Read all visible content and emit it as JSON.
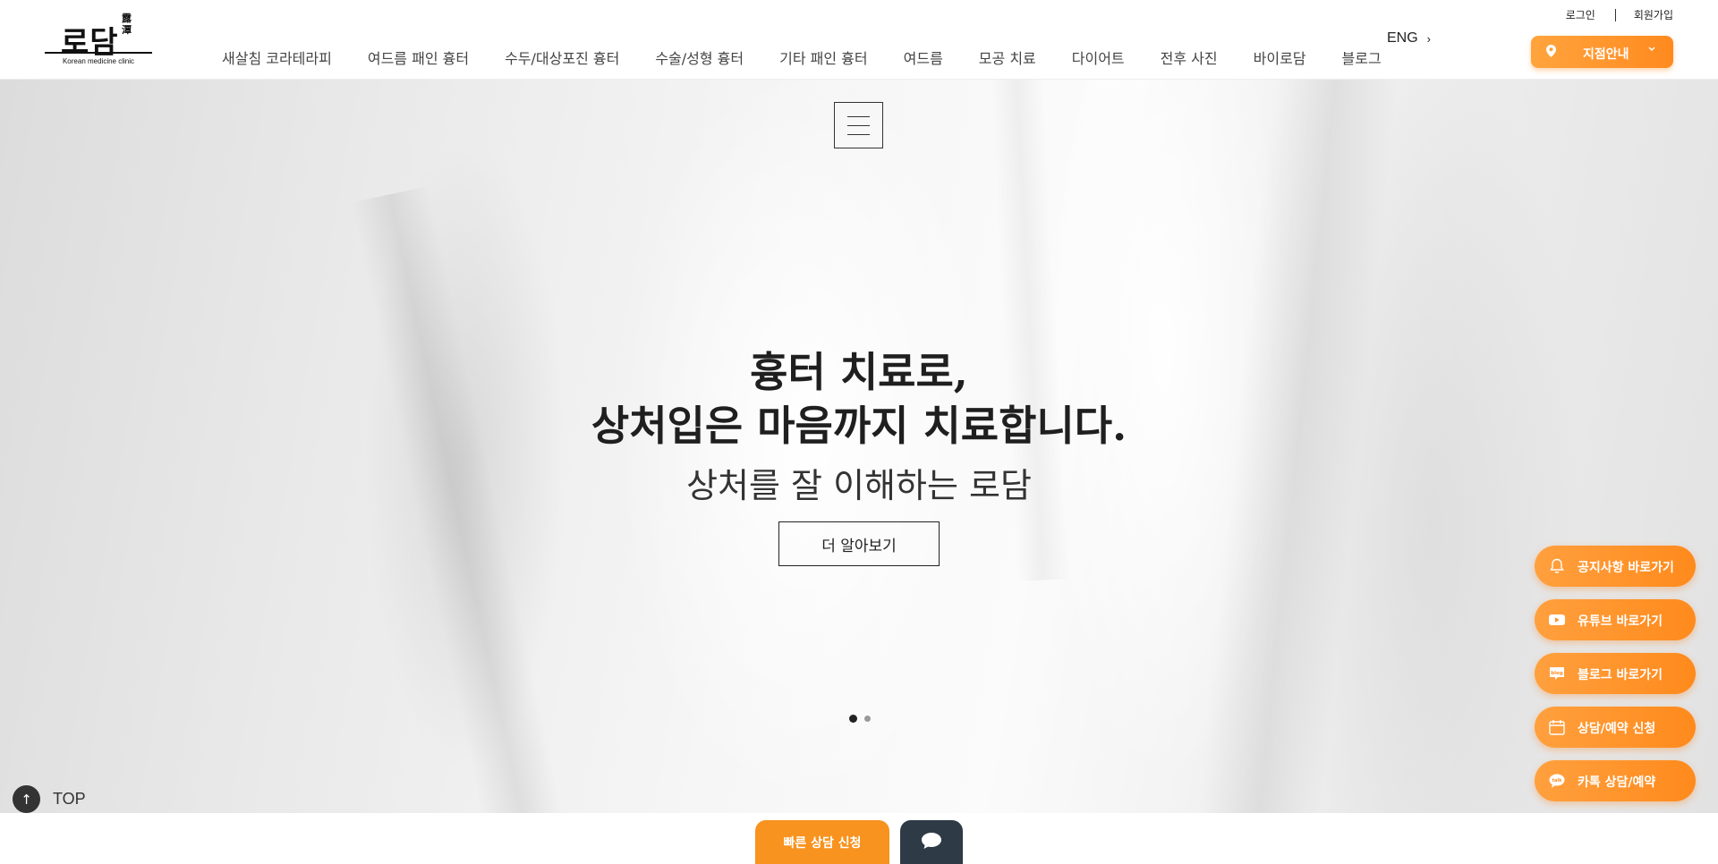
{
  "header": {
    "logo": {
      "main": "로담",
      "hanja": "露潭",
      "sub": "Korean medicine clinic"
    },
    "nav": [
      "새살침 코라테라피",
      "여드름 패인 흉터",
      "수두/대상포진 흉터",
      "수술/성형 흉터",
      "기타 패인 흉터",
      "여드름",
      "모공 치료",
      "다이어트",
      "전후 사진",
      "바이로담",
      "블로그"
    ],
    "lang": "ENG",
    "login": "로그인",
    "signup": "회원가입",
    "branch_label": "지점안내"
  },
  "hero": {
    "line1": "흉터 치료로,",
    "line2": "상처입은 마음까지 치료합니다.",
    "line3": "상처를 잘 이해하는 로담",
    "button": "더 알아보기",
    "slides": 2,
    "active_slide": 1
  },
  "top_button": "TOP",
  "quick_menu": [
    {
      "icon": "bell-icon",
      "label": "공지사항 바로가기"
    },
    {
      "icon": "youtube-icon",
      "label": "유튜브 바로가기"
    },
    {
      "icon": "blog-icon",
      "label": "블로그 바로가기"
    },
    {
      "icon": "calendar-icon",
      "label": "상담/예약 신청"
    },
    {
      "icon": "kakaotalk-icon",
      "label": "카톡 상담/예약"
    }
  ],
  "bottom": {
    "fast_consult": "빠른 상담 신청"
  },
  "colors": {
    "accent": "#ff8a1f",
    "dark": "#2e3a46"
  }
}
